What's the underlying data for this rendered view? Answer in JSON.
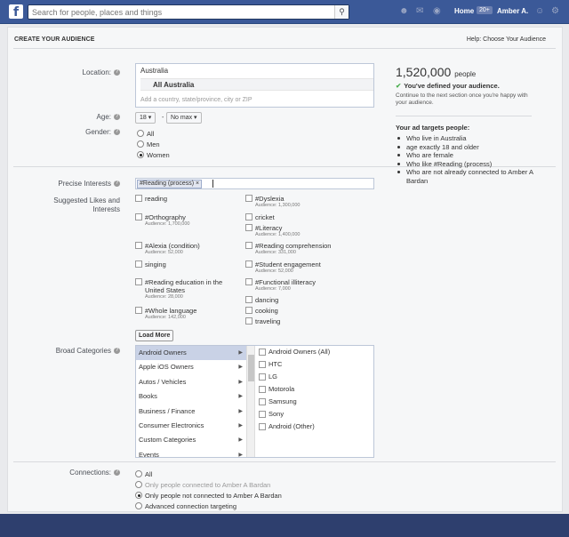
{
  "topbar": {
    "search_placeholder": "Search for people, places and things",
    "home": "Home",
    "home_badge": "20+",
    "user": "Amber A."
  },
  "header": {
    "title": "CREATE YOUR AUDIENCE",
    "help": "Help: Choose Your Audience"
  },
  "location": {
    "label": "Location:",
    "country": "Australia",
    "sub": "All Australia",
    "placeholder": "Add a country, state/province, city or ZIP"
  },
  "age": {
    "label": "Age:",
    "min": "18 ▾",
    "dash": "-",
    "max": "No max ▾"
  },
  "gender": {
    "label": "Gender:",
    "options": [
      "All",
      "Men",
      "Women"
    ],
    "selected": "Women"
  },
  "precise": {
    "label": "Precise Interests",
    "token": "#Reading (process)",
    "token_x": "×"
  },
  "suggested": {
    "label1": "Suggested Likes and",
    "label2": "Interests",
    "left": [
      {
        "name": "reading",
        "aud": ""
      },
      {
        "name": "#Orthography",
        "aud": "Audience: 1,700,000"
      },
      {
        "name": "#Alexia (condition)",
        "aud": "Audience: 52,000"
      },
      {
        "name": "singing",
        "aud": ""
      },
      {
        "name": "#Reading education in the United States",
        "aud": "Audience: 28,000"
      },
      {
        "name": "#Whole language",
        "aud": "Audience: 142,000"
      }
    ],
    "right": [
      {
        "name": "#Dyslexia",
        "aud": "Audience: 1,300,000"
      },
      {
        "name": "cricket",
        "aud": ""
      },
      {
        "name": "#Literacy",
        "aud": "Audience: 1,400,000"
      },
      {
        "name": "#Reading comprehension",
        "aud": "Audience: 331,000"
      },
      {
        "name": "#Student engagement",
        "aud": "Audience: 52,000"
      },
      {
        "name": "#Functional illiteracy",
        "aud": "Audience: 7,000"
      },
      {
        "name": "dancing",
        "aud": ""
      },
      {
        "name": "cooking",
        "aud": ""
      },
      {
        "name": "traveling",
        "aud": ""
      }
    ],
    "load_more": "Load More"
  },
  "broad": {
    "label": "Broad Categories",
    "categories": [
      "Android Owners",
      "Apple iOS Owners",
      "Autos / Vehicles",
      "Books",
      "Business / Finance",
      "Consumer Electronics",
      "Custom Categories",
      "Events"
    ],
    "subs": [
      "Android Owners (All)",
      "HTC",
      "LG",
      "Motorola",
      "Samsung",
      "Sony",
      "Android (Other)"
    ]
  },
  "connections": {
    "label": "Connections:",
    "options": [
      "All",
      "Only people connected to Amber A Bardan",
      "Only people not connected to Amber A Bardan",
      "Advanced connection targeting"
    ],
    "selected_index": 2
  },
  "reach": {
    "number": "1,520,000",
    "unit": "people",
    "defined": "You've defined your audience.",
    "note": "Continue to the next section once you're happy with your audience."
  },
  "targets": {
    "title": "Your ad targets people:",
    "items": [
      "Who live in Australia",
      "age exactly 18 and older",
      "Who are female",
      "Who like #Reading (process)",
      "Who are not already connected to Amber A Bardan"
    ]
  }
}
